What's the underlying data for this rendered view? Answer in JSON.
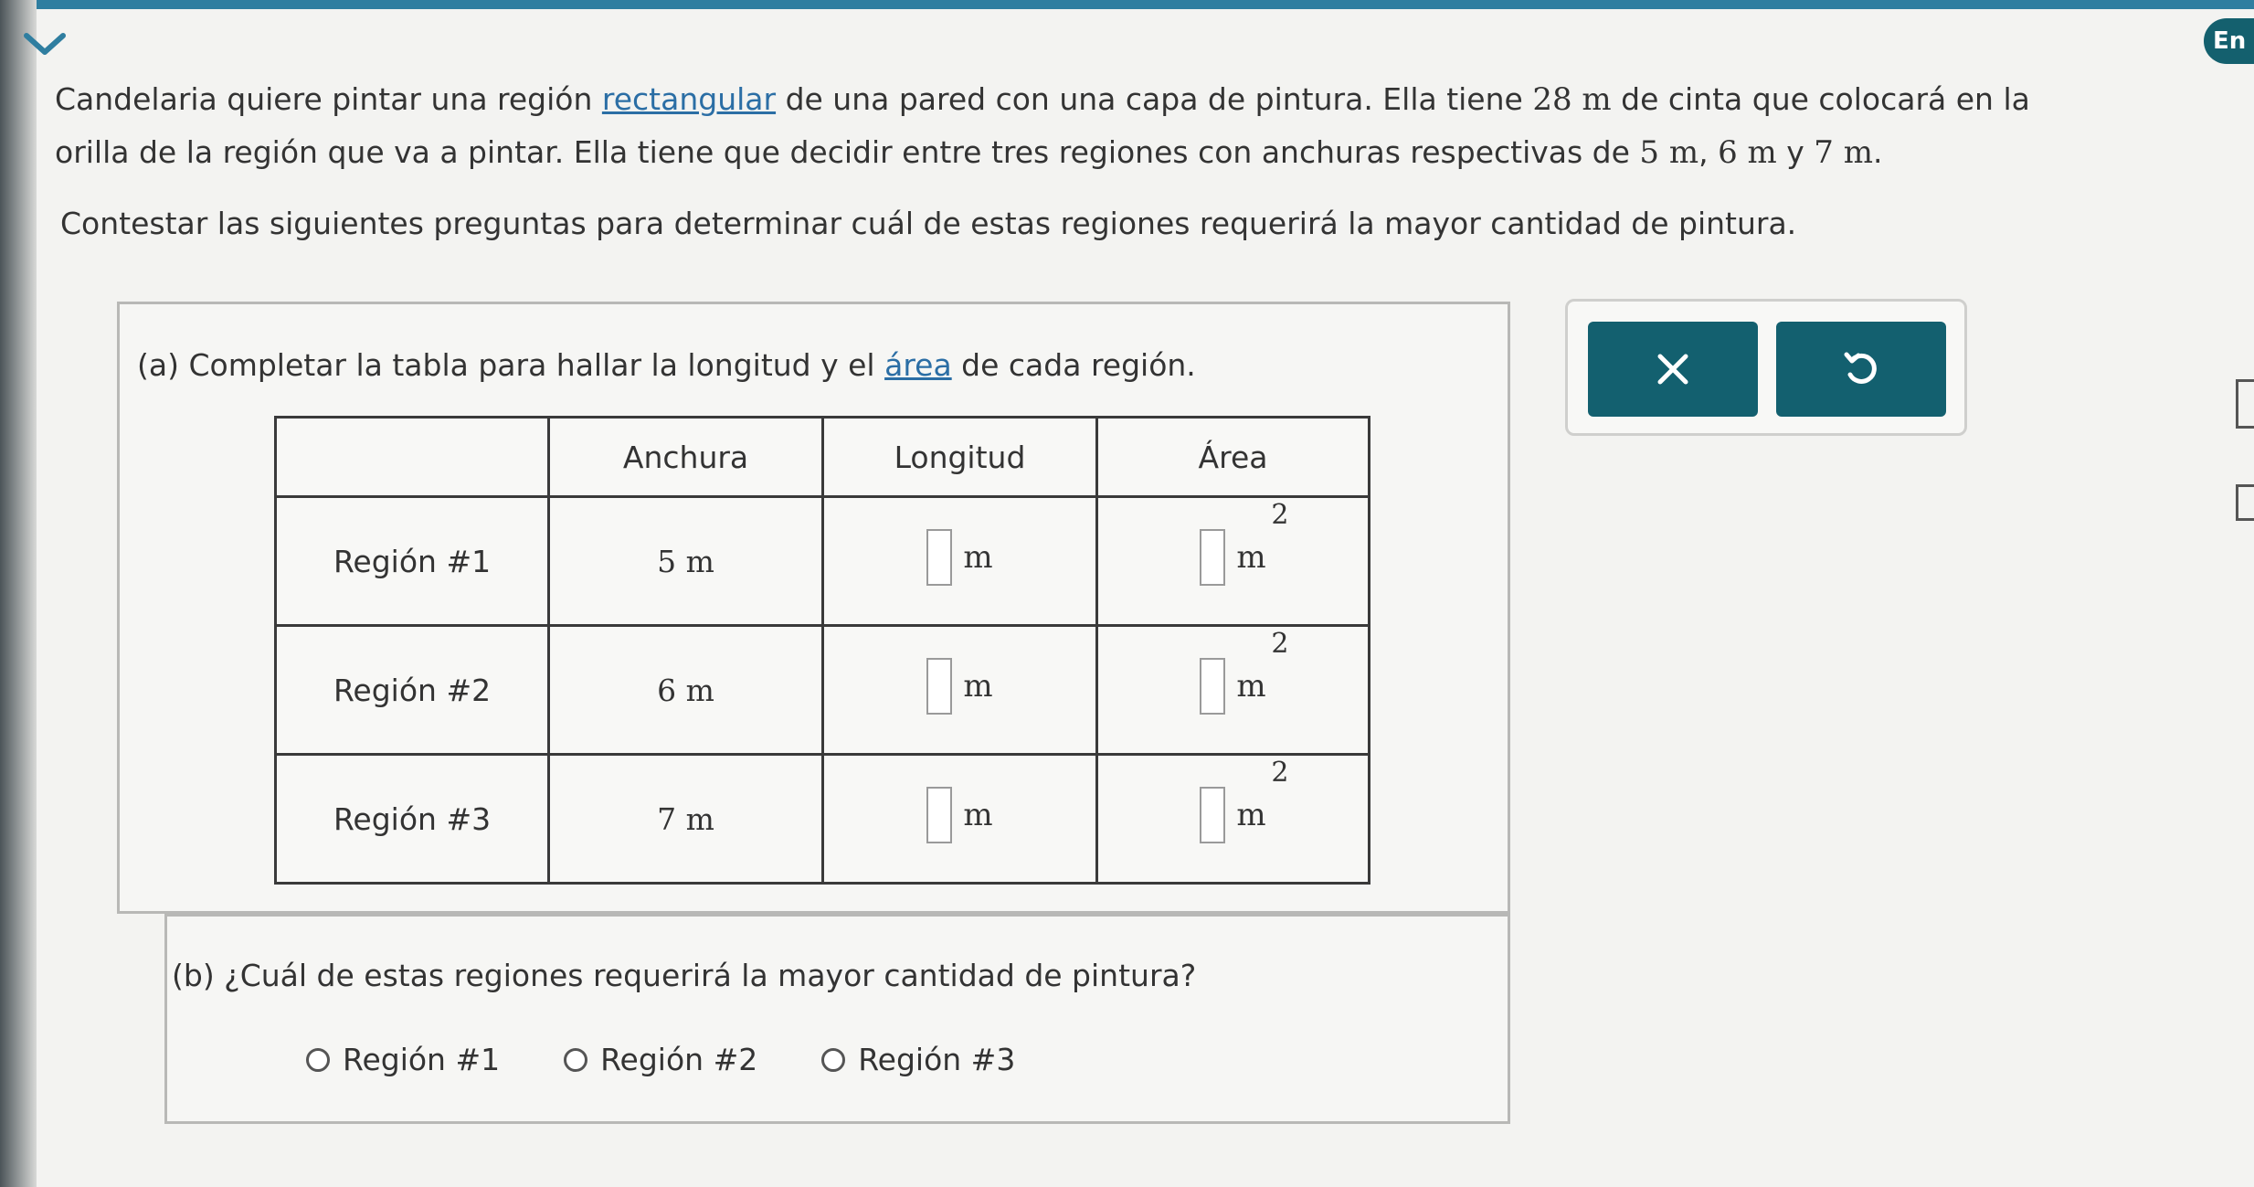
{
  "header": {
    "language_badge": "En"
  },
  "problem": {
    "line1_pre": "Candelaria quiere pintar una región ",
    "line1_link": "rectangular",
    "line1_mid": " de una pared con una capa de pintura. Ella tiene ",
    "tape_length": "28 m",
    "line1_post": " de cinta que colocará en la",
    "line2_pre": "orilla de la región que va a pintar. Ella tiene que decidir entre tres regiones con anchuras respectivas de ",
    "width_1": "5 m",
    "sep_1": ", ",
    "width_2": "6 m",
    "sep_2": " y ",
    "width_3": "7 m",
    "line2_post": ".",
    "instruction": "Contestar las siguientes preguntas para determinar cuál de estas regiones requerirá la mayor cantidad de pintura."
  },
  "part_a": {
    "label_pre": "(a)  Completar la tabla para hallar la longitud y el ",
    "label_link": "área",
    "label_post": " de cada región.",
    "headers": [
      "",
      "Anchura",
      "Longitud",
      "Área"
    ],
    "rows": [
      {
        "name": "Región #1",
        "width": "5 m",
        "length_unit": "m",
        "area_unit": "m",
        "area_exp": "2"
      },
      {
        "name": "Región #2",
        "width": "6 m",
        "length_unit": "m",
        "area_unit": "m",
        "area_exp": "2"
      },
      {
        "name": "Región #3",
        "width": "7 m",
        "length_unit": "m",
        "area_unit": "m",
        "area_exp": "2"
      }
    ]
  },
  "part_b": {
    "label": "(b)  ¿Cuál de estas regiones requerirá la mayor cantidad de pintura?",
    "options": [
      "Región #1",
      "Región #2",
      "Región #3"
    ]
  },
  "actions": {
    "clear_icon": "close-icon",
    "undo_icon": "undo-icon"
  },
  "colors": {
    "accent": "#13606f",
    "topbar": "#2f7ea0",
    "link": "#2b6ea5"
  }
}
